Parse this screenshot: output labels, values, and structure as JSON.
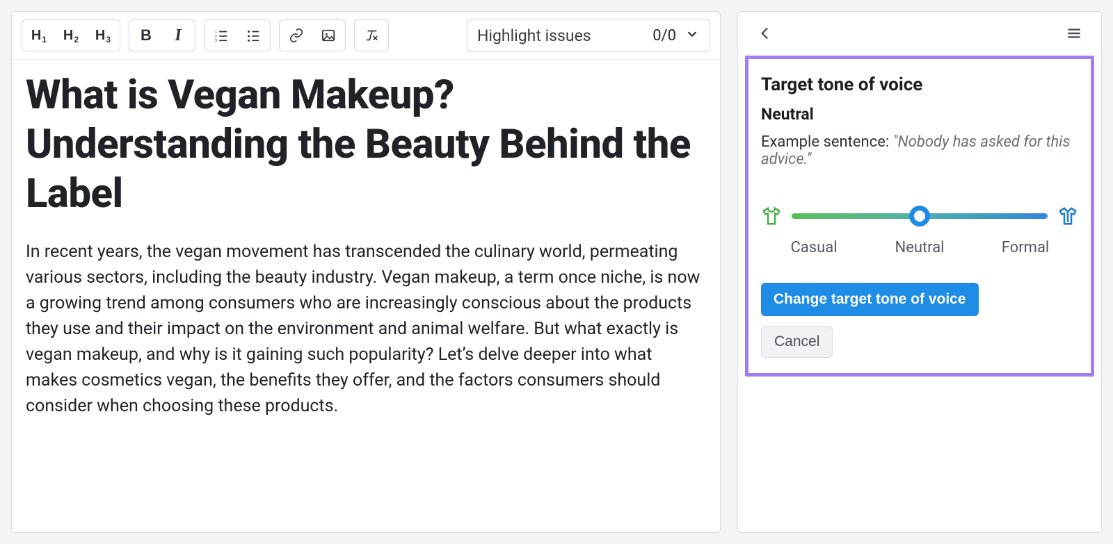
{
  "toolbar": {
    "headings": {
      "h1": "H",
      "h1_sub": "1",
      "h2": "H",
      "h2_sub": "2",
      "h3": "H",
      "h3_sub": "3"
    },
    "highlight_dropdown_label": "Highlight issues",
    "highlight_dropdown_count": "0/0"
  },
  "document": {
    "title": "What is Vegan Makeup? Understanding the Beauty Behind the Label",
    "body": "In recent years, the vegan movement has transcended the culinary world, permeating various sectors, including the beauty industry. Vegan makeup, a term once niche, is now a growing trend among consumers who are increasingly conscious about the products they use and their impact on the environment and animal welfare. But what exactly is vegan makeup, and why is it gaining such popularity? Let’s delve deeper into what makes cosmetics vegan, the benefits they offer, and the factors consumers should consider when choosing these products."
  },
  "sidebar": {
    "tone_panel": {
      "title": "Target tone of voice",
      "selected": "Neutral",
      "example_lead": "Example sentence: ",
      "example_quote": "\"Nobody has asked for this advice.\"",
      "slider": {
        "labels": {
          "casual": "Casual",
          "neutral": "Neutral",
          "formal": "Formal"
        }
      },
      "change_button": "Change target tone of voice",
      "cancel_button": "Cancel"
    }
  }
}
